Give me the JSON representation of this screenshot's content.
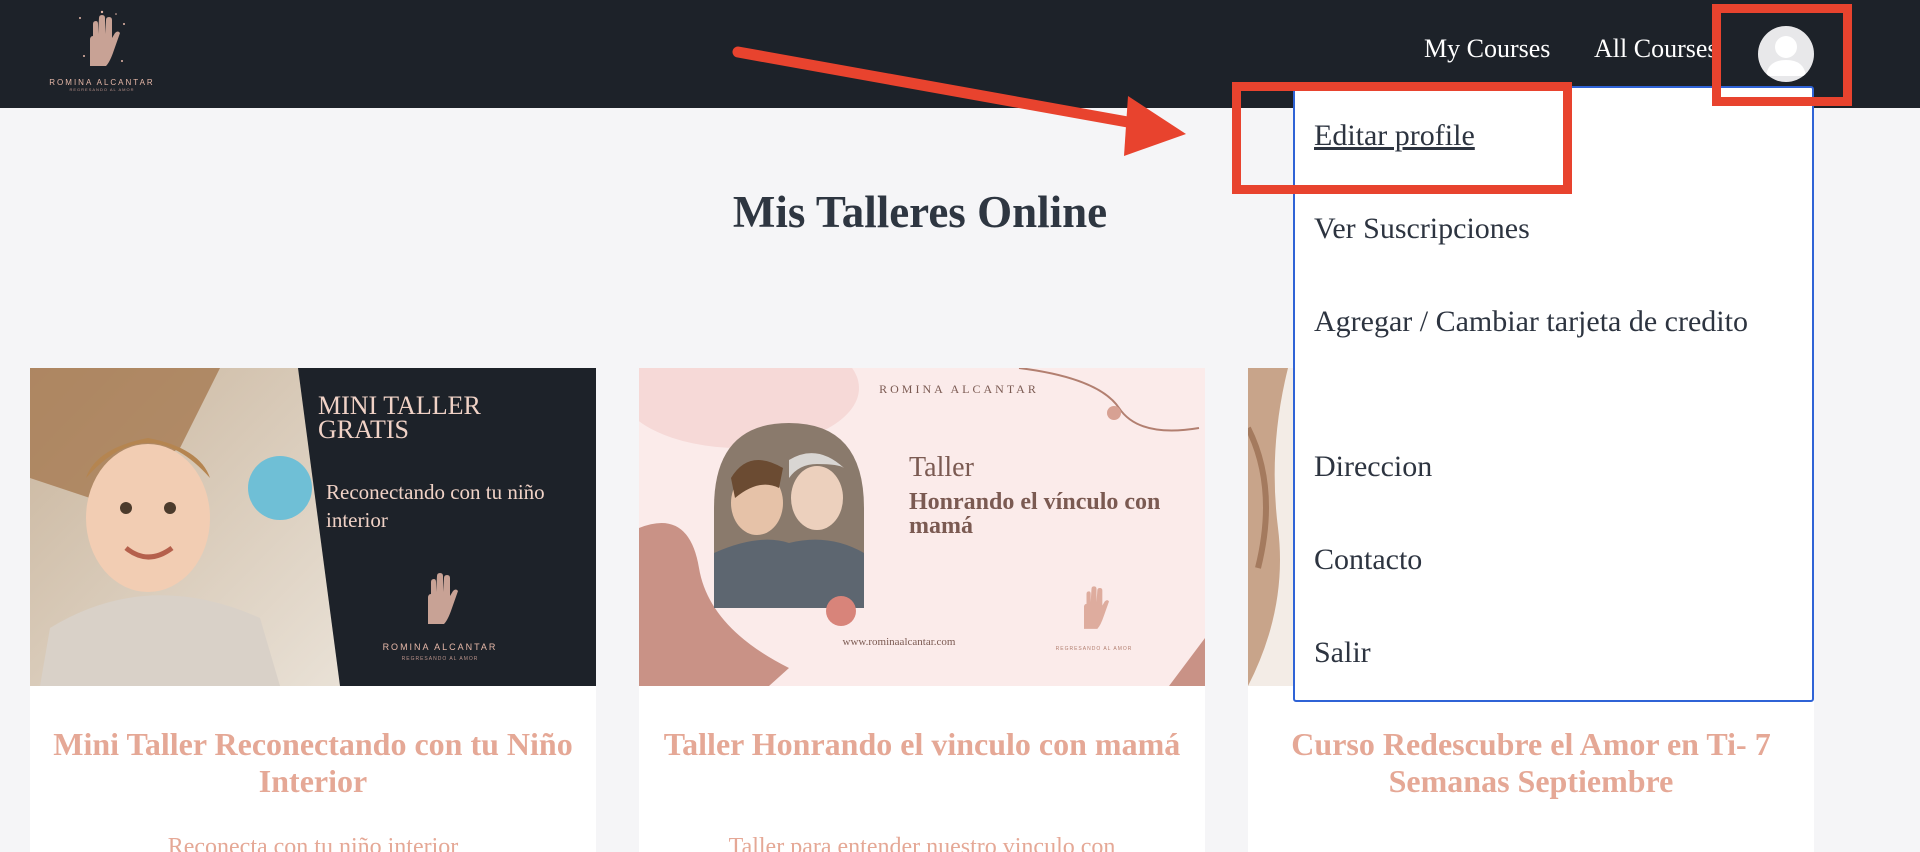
{
  "header": {
    "logo": {
      "name": "ROMINA ALCANTAR",
      "tagline": "REGRESANDO AL AMOR"
    },
    "nav": {
      "my_courses": "My Courses",
      "all_courses": "All Courses"
    }
  },
  "main": {
    "title": "Mis Talleres Online"
  },
  "cards": [
    {
      "title": "Mini Taller Reconectando con tu Niño Interior",
      "description": "Reconecta con tu niño interior",
      "thumb": {
        "heading": "MINI TALLER GRATIS",
        "subtitle": "Reconectando con tu niño interior",
        "brand": "ROMINA ALCANTAR",
        "tagline": "REGRESANDO AL AMOR"
      }
    },
    {
      "title": "Taller Honrando el vinculo con mamá",
      "description": "Taller para entender nuestro vinculo con",
      "thumb": {
        "brand": "ROMINA ALCANTAR",
        "kicker": "Taller",
        "heading": "Honrando el vínculo con mamá",
        "url": "www.rominaalcantar.com",
        "tagline": "REGRESANDO AL AMOR"
      }
    },
    {
      "title": "Curso Redescubre el Amor en Ti- 7 Semanas Septiembre",
      "description": ""
    }
  ],
  "dropdown": {
    "items": [
      "Editar profile",
      "Ver Suscripciones",
      "Agregar / Cambiar tarjeta de credito",
      "Direccion",
      "Contacto",
      "Salir"
    ]
  },
  "colors": {
    "header_bg": "#1d2229",
    "page_bg": "#f5f5f7",
    "card_title": "#e5a896",
    "dropdown_border": "#2f63d6",
    "annotation": "#e8432e"
  }
}
